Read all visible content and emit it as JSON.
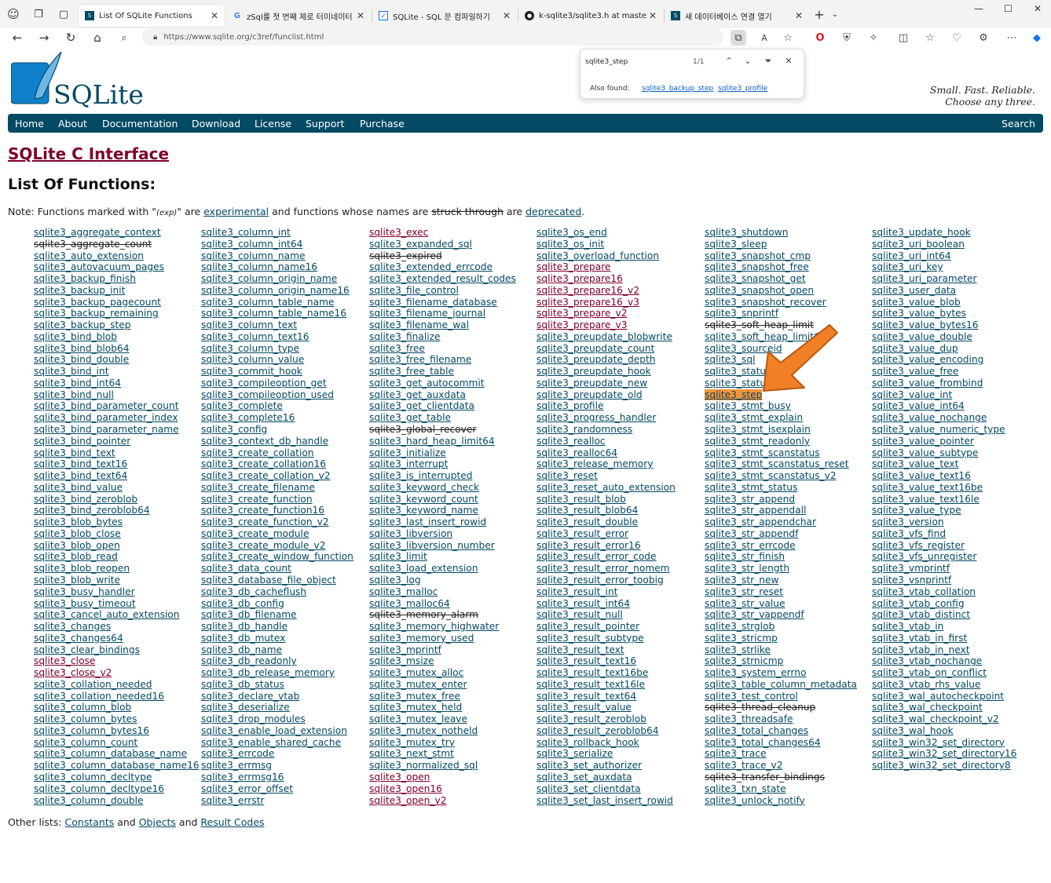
{
  "browser": {
    "tabs": [
      {
        "title": "List Of SQLite Functions",
        "icon": "sqlite-favicon",
        "active": true
      },
      {
        "title": "zSql를 첫 번째 제로 터미네이터",
        "icon": "google-icon"
      },
      {
        "title": "SQLite - SQL 문 컴파일하기",
        "icon": "bookmark-icon"
      },
      {
        "title": "k-sqlite3/sqlite3.h at master · ne",
        "icon": "github-icon"
      },
      {
        "title": "새 데이터베이스 연결 열기",
        "icon": "sqlite-favicon"
      }
    ],
    "url": "https://www.sqlite.org/c3ref/funclist.html"
  },
  "findbar": {
    "query": "sqlite3_step",
    "count": "1/1",
    "also_found_label": "Also found:",
    "also_found": [
      "sqlite3_backup_step",
      "sqlite3_profile"
    ]
  },
  "header": {
    "logo_text": "SQLite",
    "tagline_1": "Small. Fast. Reliable.",
    "tagline_2": "Choose any three."
  },
  "nav": {
    "items": [
      "Home",
      "About",
      "Documentation",
      "Download",
      "License",
      "Support",
      "Purchase"
    ],
    "search": "Search"
  },
  "page": {
    "heading": "SQLite C Interface",
    "subheading": "List Of Functions:",
    "note_prefix": "Note: Functions marked with \"",
    "note_exp": "(exp)",
    "note_mid1": "\" are ",
    "note_link1": "experimental",
    "note_mid2": " and functions whose names are ",
    "note_struck": "struck through",
    "note_mid3": " are ",
    "note_link2": "deprecated",
    "note_end": ".",
    "other_prefix": "Other lists: ",
    "other_links": [
      "Constants",
      "Objects",
      "Result Codes"
    ],
    "other_and": " and "
  },
  "columns": [
    [
      "sqlite3_aggregate_context",
      "~sqlite3_aggregate_count",
      "sqlite3_auto_extension",
      "sqlite3_autovacuum_pages",
      "sqlite3_backup_finish",
      "sqlite3_backup_init",
      "sqlite3_backup_pagecount",
      "sqlite3_backup_remaining",
      "sqlite3_backup_step",
      "sqlite3_bind_blob",
      "sqlite3_bind_blob64",
      "sqlite3_bind_double",
      "sqlite3_bind_int",
      "sqlite3_bind_int64",
      "sqlite3_bind_null",
      "sqlite3_bind_parameter_count",
      "sqlite3_bind_parameter_index",
      "sqlite3_bind_parameter_name",
      "sqlite3_bind_pointer",
      "sqlite3_bind_text",
      "sqlite3_bind_text16",
      "sqlite3_bind_text64",
      "sqlite3_bind_value",
      "sqlite3_bind_zeroblob",
      "sqlite3_bind_zeroblob64",
      "sqlite3_blob_bytes",
      "sqlite3_blob_close",
      "sqlite3_blob_open",
      "sqlite3_blob_read",
      "sqlite3_blob_reopen",
      "sqlite3_blob_write",
      "sqlite3_busy_handler",
      "sqlite3_busy_timeout",
      "sqlite3_cancel_auto_extension",
      "sqlite3_changes",
      "sqlite3_changes64",
      "sqlite3_clear_bindings",
      "^sqlite3_close",
      "^sqlite3_close_v2",
      "sqlite3_collation_needed",
      "sqlite3_collation_needed16",
      "sqlite3_column_blob",
      "sqlite3_column_bytes",
      "sqlite3_column_bytes16",
      "sqlite3_column_count",
      "sqlite3_column_database_name",
      "sqlite3_column_database_name16",
      "sqlite3_column_decltype",
      "sqlite3_column_decltype16",
      "sqlite3_column_double"
    ],
    [
      "sqlite3_column_int",
      "sqlite3_column_int64",
      "sqlite3_column_name",
      "sqlite3_column_name16",
      "sqlite3_column_origin_name",
      "sqlite3_column_origin_name16",
      "sqlite3_column_table_name",
      "sqlite3_column_table_name16",
      "sqlite3_column_text",
      "sqlite3_column_text16",
      "sqlite3_column_type",
      "sqlite3_column_value",
      "sqlite3_commit_hook",
      "sqlite3_compileoption_get",
      "sqlite3_compileoption_used",
      "sqlite3_complete",
      "sqlite3_complete16",
      "sqlite3_config",
      "sqlite3_context_db_handle",
      "sqlite3_create_collation",
      "sqlite3_create_collation16",
      "sqlite3_create_collation_v2",
      "sqlite3_create_filename",
      "sqlite3_create_function",
      "sqlite3_create_function16",
      "sqlite3_create_function_v2",
      "sqlite3_create_module",
      "sqlite3_create_module_v2",
      "sqlite3_create_window_function",
      "sqlite3_data_count",
      "sqlite3_database_file_object",
      "sqlite3_db_cacheflush",
      "sqlite3_db_config",
      "sqlite3_db_filename",
      "sqlite3_db_handle",
      "sqlite3_db_mutex",
      "sqlite3_db_name",
      "sqlite3_db_readonly",
      "sqlite3_db_release_memory",
      "sqlite3_db_status",
      "sqlite3_declare_vtab",
      "sqlite3_deserialize",
      "sqlite3_drop_modules",
      "sqlite3_enable_load_extension",
      "sqlite3_enable_shared_cache",
      "sqlite3_errcode",
      "sqlite3_errmsg",
      "sqlite3_errmsg16",
      "sqlite3_error_offset",
      "sqlite3_errstr"
    ],
    [
      "^sqlite3_exec",
      "sqlite3_expanded_sql",
      "~sqlite3_expired",
      "sqlite3_extended_errcode",
      "sqlite3_extended_result_codes",
      "sqlite3_file_control",
      "sqlite3_filename_database",
      "sqlite3_filename_journal",
      "sqlite3_filename_wal",
      "sqlite3_finalize",
      "sqlite3_free",
      "sqlite3_free_filename",
      "sqlite3_free_table",
      "sqlite3_get_autocommit",
      "sqlite3_get_auxdata",
      "sqlite3_get_clientdata",
      "sqlite3_get_table",
      "~sqlite3_global_recover",
      "sqlite3_hard_heap_limit64",
      "sqlite3_initialize",
      "sqlite3_interrupt",
      "sqlite3_is_interrupted",
      "sqlite3_keyword_check",
      "sqlite3_keyword_count",
      "sqlite3_keyword_name",
      "sqlite3_last_insert_rowid",
      "sqlite3_libversion",
      "sqlite3_libversion_number",
      "sqlite3_limit",
      "sqlite3_load_extension",
      "sqlite3_log",
      "sqlite3_malloc",
      "sqlite3_malloc64",
      "~sqlite3_memory_alarm",
      "sqlite3_memory_highwater",
      "sqlite3_memory_used",
      "sqlite3_mprintf",
      "sqlite3_msize",
      "sqlite3_mutex_alloc",
      "sqlite3_mutex_enter",
      "sqlite3_mutex_free",
      "sqlite3_mutex_held",
      "sqlite3_mutex_leave",
      "sqlite3_mutex_notheld",
      "sqlite3_mutex_try",
      "sqlite3_next_stmt",
      "sqlite3_normalized_sql",
      "^sqlite3_open",
      "^sqlite3_open16",
      "^sqlite3_open_v2"
    ],
    [
      "sqlite3_os_end",
      "sqlite3_os_init",
      "sqlite3_overload_function",
      "^sqlite3_prepare",
      "^sqlite3_prepare16",
      "^sqlite3_prepare16_v2",
      "^sqlite3_prepare16_v3",
      "^sqlite3_prepare_v2",
      "^sqlite3_prepare_v3",
      "sqlite3_preupdate_blobwrite",
      "sqlite3_preupdate_count",
      "sqlite3_preupdate_depth",
      "sqlite3_preupdate_hook",
      "sqlite3_preupdate_new",
      "sqlite3_preupdate_old",
      "sqlite3_profile",
      "sqlite3_progress_handler",
      "sqlite3_randomness",
      "sqlite3_realloc",
      "sqlite3_realloc64",
      "sqlite3_release_memory",
      "sqlite3_reset",
      "sqlite3_reset_auto_extension",
      "sqlite3_result_blob",
      "sqlite3_result_blob64",
      "sqlite3_result_double",
      "sqlite3_result_error",
      "sqlite3_result_error16",
      "sqlite3_result_error_code",
      "sqlite3_result_error_nomem",
      "sqlite3_result_error_toobig",
      "sqlite3_result_int",
      "sqlite3_result_int64",
      "sqlite3_result_null",
      "sqlite3_result_pointer",
      "sqlite3_result_subtype",
      "sqlite3_result_text",
      "sqlite3_result_text16",
      "sqlite3_result_text16be",
      "sqlite3_result_text16le",
      "sqlite3_result_text64",
      "sqlite3_result_value",
      "sqlite3_result_zeroblob",
      "sqlite3_result_zeroblob64",
      "sqlite3_rollback_hook",
      "sqlite3_serialize",
      "sqlite3_set_authorizer",
      "sqlite3_set_auxdata",
      "sqlite3_set_clientdata",
      "sqlite3_set_last_insert_rowid"
    ],
    [
      "sqlite3_shutdown",
      "sqlite3_sleep",
      "sqlite3_snapshot_cmp",
      "sqlite3_snapshot_free",
      "sqlite3_snapshot_get",
      "sqlite3_snapshot_open",
      "sqlite3_snapshot_recover",
      "sqlite3_snprintf",
      "~sqlite3_soft_heap_limit",
      "sqlite3_soft_heap_limit64",
      "sqlite3_sourceid",
      "sqlite3_sql",
      "sqlite3_status",
      "sqlite3_status64",
      "*sqlite3_step",
      "sqlite3_stmt_busy",
      "sqlite3_stmt_explain",
      "sqlite3_stmt_isexplain",
      "sqlite3_stmt_readonly",
      "sqlite3_stmt_scanstatus",
      "sqlite3_stmt_scanstatus_reset",
      "sqlite3_stmt_scanstatus_v2",
      "sqlite3_stmt_status",
      "sqlite3_str_append",
      "sqlite3_str_appendall",
      "sqlite3_str_appendchar",
      "sqlite3_str_appendf",
      "sqlite3_str_errcode",
      "sqlite3_str_finish",
      "sqlite3_str_length",
      "sqlite3_str_new",
      "sqlite3_str_reset",
      "sqlite3_str_value",
      "sqlite3_str_vappendf",
      "sqlite3_strglob",
      "sqlite3_stricmp",
      "sqlite3_strlike",
      "sqlite3_strnicmp",
      "sqlite3_system_errno",
      "sqlite3_table_column_metadata",
      "sqlite3_test_control",
      "~sqlite3_thread_cleanup",
      "sqlite3_threadsafe",
      "sqlite3_total_changes",
      "sqlite3_total_changes64",
      "sqlite3_trace",
      "sqlite3_trace_v2",
      "~sqlite3_transfer_bindings",
      "sqlite3_txn_state",
      "sqlite3_unlock_notify"
    ],
    [
      "sqlite3_update_hook",
      "sqlite3_uri_boolean",
      "sqlite3_uri_int64",
      "sqlite3_uri_key",
      "sqlite3_uri_parameter",
      "sqlite3_user_data",
      "sqlite3_value_blob",
      "sqlite3_value_bytes",
      "sqlite3_value_bytes16",
      "sqlite3_value_double",
      "sqlite3_value_dup",
      "sqlite3_value_encoding",
      "sqlite3_value_free",
      "sqlite3_value_frombind",
      "sqlite3_value_int",
      "sqlite3_value_int64",
      "sqlite3_value_nochange",
      "sqlite3_value_numeric_type",
      "sqlite3_value_pointer",
      "sqlite3_value_subtype",
      "sqlite3_value_text",
      "sqlite3_value_text16",
      "sqlite3_value_text16be",
      "sqlite3_value_text16le",
      "sqlite3_value_type",
      "sqlite3_version",
      "sqlite3_vfs_find",
      "sqlite3_vfs_register",
      "sqlite3_vfs_unregister",
      "sqlite3_vmprintf",
      "sqlite3_vsnprintf",
      "sqlite3_vtab_collation",
      "sqlite3_vtab_config",
      "sqlite3_vtab_distinct",
      "sqlite3_vtab_in",
      "sqlite3_vtab_in_first",
      "sqlite3_vtab_in_next",
      "sqlite3_vtab_nochange",
      "sqlite3_vtab_on_conflict",
      "sqlite3_vtab_rhs_value",
      "sqlite3_wal_autocheckpoint",
      "sqlite3_wal_checkpoint",
      "sqlite3_wal_checkpoint_v2",
      "sqlite3_wal_hook",
      "sqlite3_win32_set_directory",
      "sqlite3_win32_set_directory16",
      "sqlite3_win32_set_directory8"
    ]
  ],
  "colors": {
    "link": "#044a64",
    "visited": "#80002a",
    "nav_bg": "#044a64",
    "highlight": "#f7943a",
    "arrow": "#f07f25"
  }
}
